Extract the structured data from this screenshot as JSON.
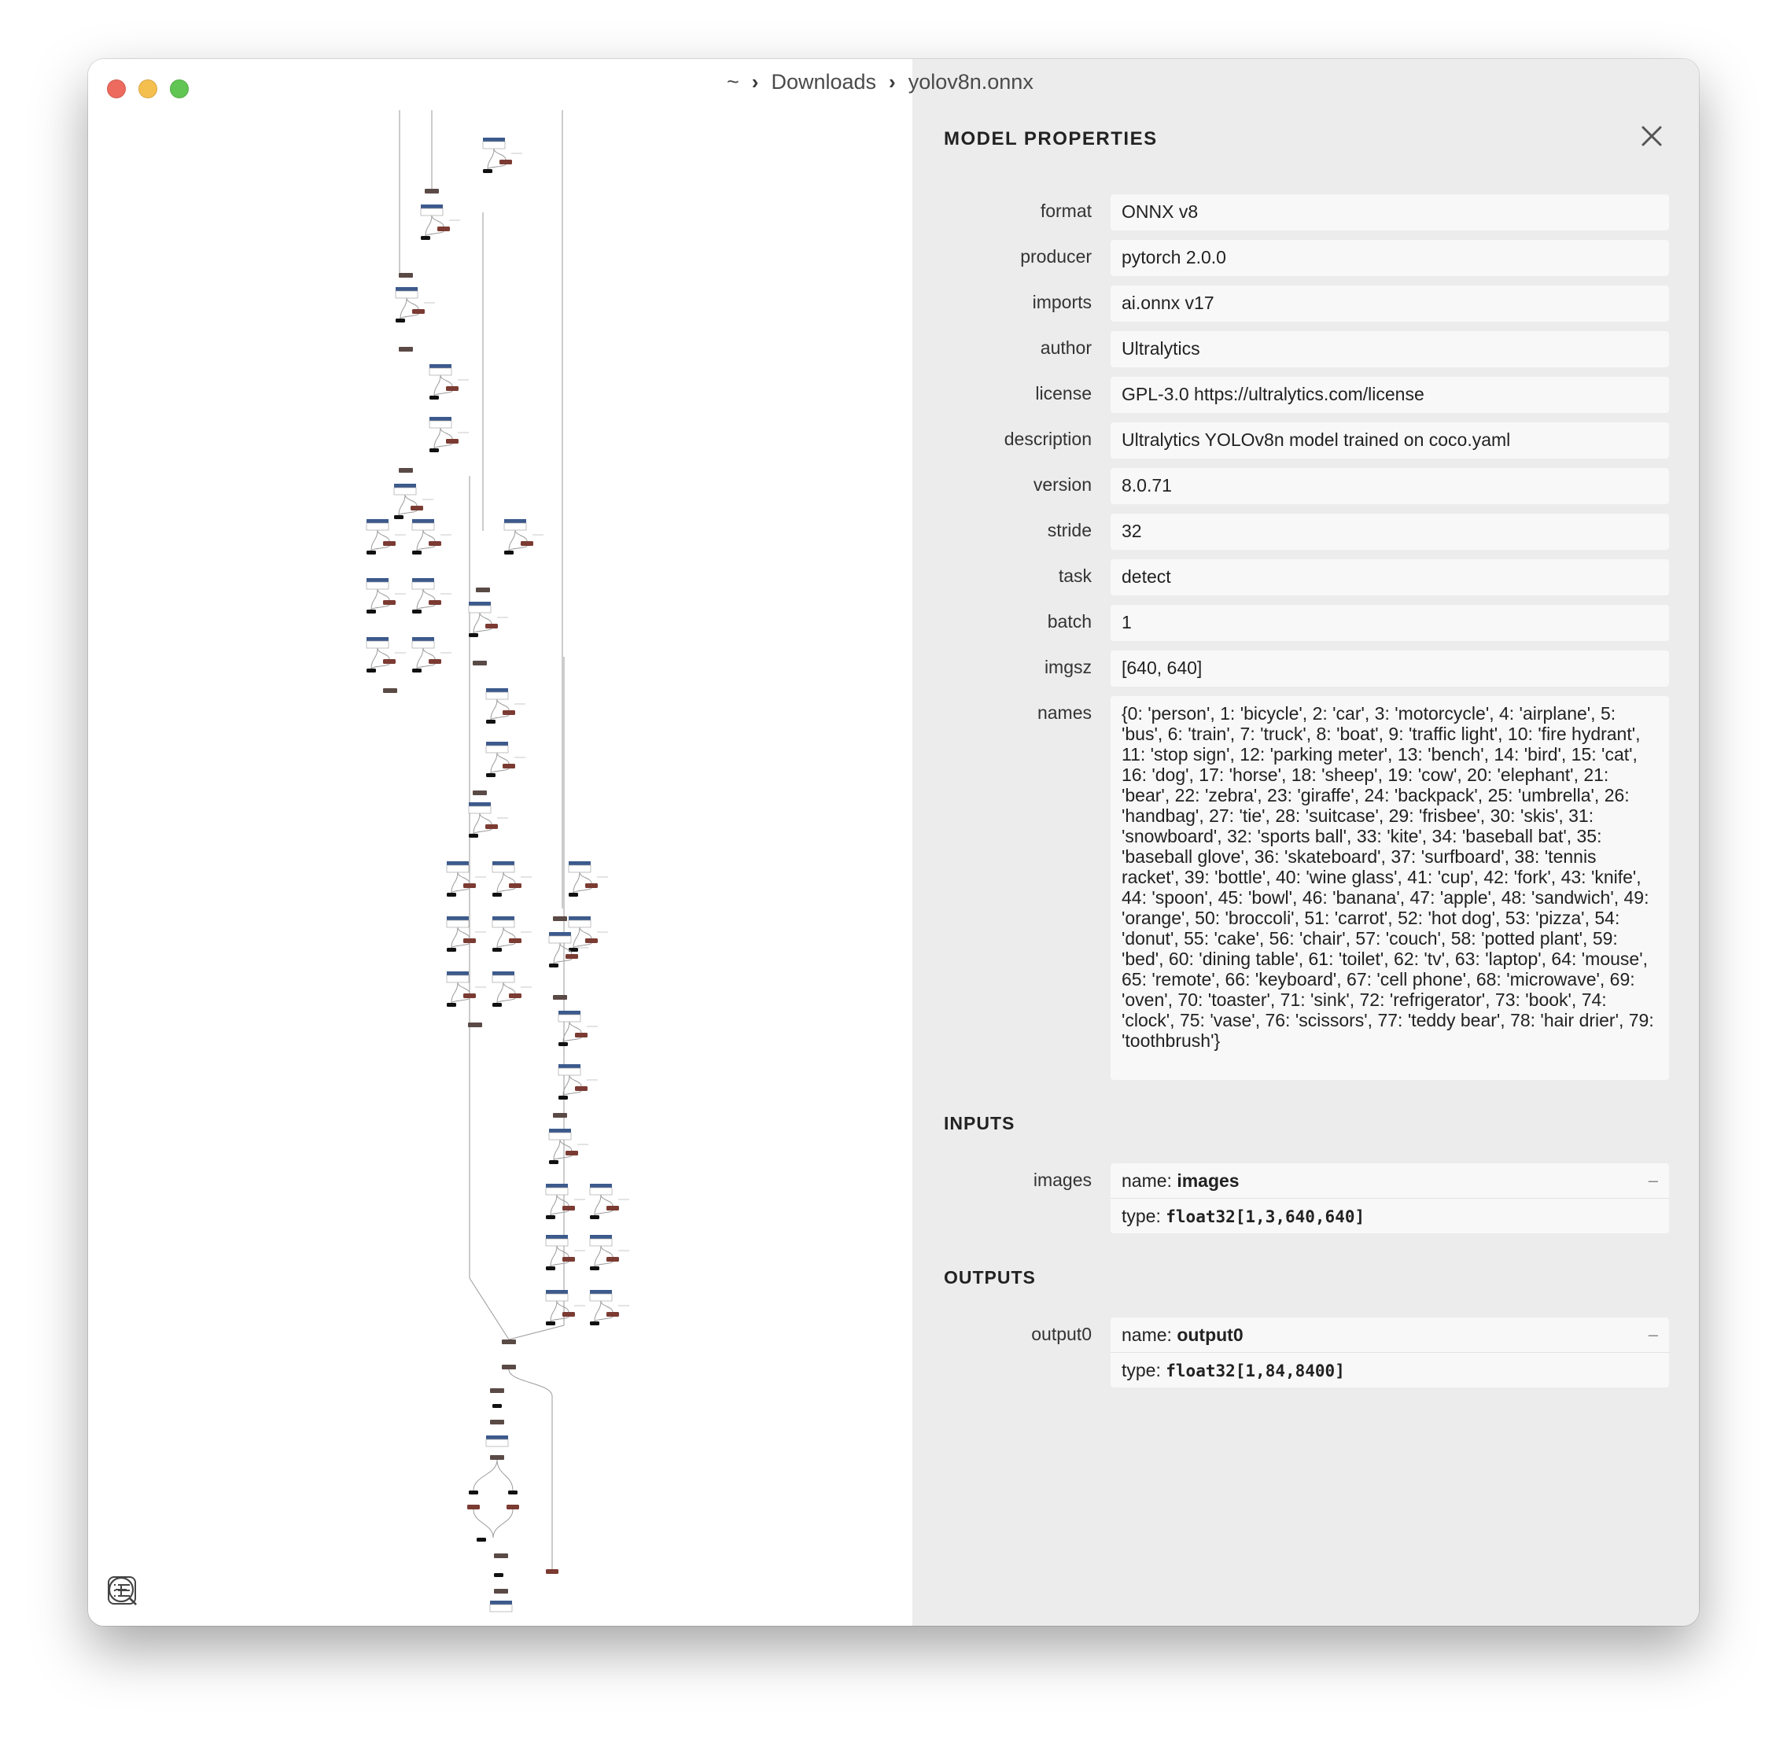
{
  "window": {
    "breadcrumb": [
      "~",
      "Downloads",
      "yolov8n.onnx"
    ]
  },
  "panel": {
    "title": "MODEL PROPERTIES",
    "properties": [
      {
        "label": "format",
        "value": "ONNX v8"
      },
      {
        "label": "producer",
        "value": "pytorch 2.0.0"
      },
      {
        "label": "imports",
        "value": "ai.onnx v17"
      },
      {
        "label": "author",
        "value": "Ultralytics"
      },
      {
        "label": "license",
        "value": "GPL-3.0 https://ultralytics.com/license"
      },
      {
        "label": "description",
        "value": "Ultralytics YOLOv8n model trained on coco.yaml"
      },
      {
        "label": "version",
        "value": "8.0.71"
      },
      {
        "label": "stride",
        "value": "32"
      },
      {
        "label": "task",
        "value": "detect"
      },
      {
        "label": "batch",
        "value": "1"
      },
      {
        "label": "imgsz",
        "value": "[640, 640]"
      },
      {
        "label": "names",
        "value": "{0: 'person', 1: 'bicycle', 2: 'car', 3: 'motorcycle', 4: 'airplane', 5: 'bus', 6: 'train', 7: 'truck', 8: 'boat', 9: 'traffic light', 10: 'fire hydrant', 11: 'stop sign', 12: 'parking meter', 13: 'bench', 14: 'bird', 15: 'cat', 16: 'dog', 17: 'horse', 18: 'sheep', 19: 'cow', 20: 'elephant', 21: 'bear', 22: 'zebra', 23: 'giraffe', 24: 'backpack', 25: 'umbrella', 26: 'handbag', 27: 'tie', 28: 'suitcase', 29: 'frisbee', 30: 'skis', 31: 'snowboard', 32: 'sports ball', 33: 'kite', 34: 'baseball bat', 35: 'baseball glove', 36: 'skateboard', 37: 'surfboard', 38: 'tennis racket', 39: 'bottle', 40: 'wine glass', 41: 'cup', 42: 'fork', 43: 'knife', 44: 'spoon', 45: 'bowl', 46: 'banana', 47: 'apple', 48: 'sandwich', 49: 'orange', 50: 'broccoli', 51: 'carrot', 52: 'hot dog', 53: 'pizza', 54: 'donut', 55: 'cake', 56: 'chair', 57: 'couch', 58: 'potted plant', 59: 'bed', 60: 'dining table', 61: 'toilet', 62: 'tv', 63: 'laptop', 64: 'mouse', 65: 'remote', 66: 'keyboard', 67: 'cell phone', 68: 'microwave', 69: 'oven', 70: 'toaster', 71: 'sink', 72: 'refrigerator', 73: 'book', 74: 'clock', 75: 'vase', 76: 'scissors', 77: 'teddy bear', 78: 'hair drier', 79: 'toothbrush'}"
      }
    ],
    "inputs": {
      "title": "INPUTS",
      "items": [
        {
          "label": "images",
          "name_prefix": "name: ",
          "name": "images",
          "type_prefix": "type: ",
          "type": "float32[1,3,640,640]",
          "toggle": "–"
        }
      ]
    },
    "outputs": {
      "title": "OUTPUTS",
      "items": [
        {
          "label": "output0",
          "name_prefix": "name: ",
          "name": "output0",
          "type_prefix": "type: ",
          "type": "float32[1,84,8400]",
          "toggle": "–"
        }
      ]
    }
  },
  "colors": {
    "conv_node": "#3c5a8c",
    "op_node": "#7b3b32",
    "act_node": "#111111",
    "concat_node": "#5a4a46"
  },
  "icons": {
    "close": "close-icon",
    "sidebar_toggle": "list-icon",
    "zoom_in": "zoom-in-icon",
    "zoom_out": "zoom-out-icon"
  }
}
